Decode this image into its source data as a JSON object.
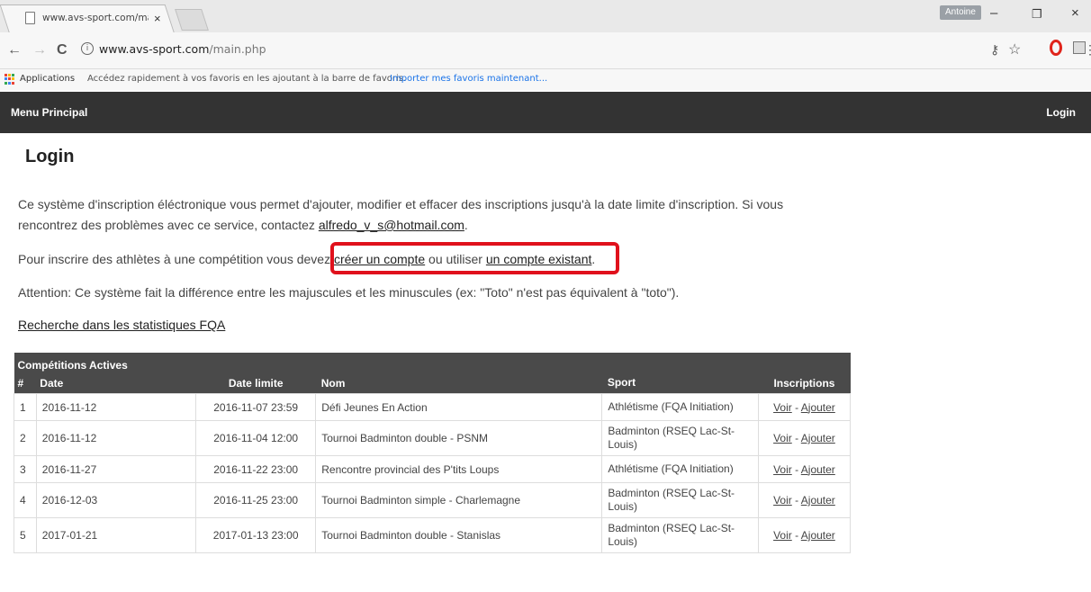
{
  "browser": {
    "tab_title": "www.avs-sport.com/main.php",
    "tab_close": "×",
    "profile_name": "Antoine",
    "url_host": "www.avs-sport.com",
    "url_path": "/main.php",
    "info_glyph": "i",
    "back_icon": "←",
    "forward_icon": "→",
    "reload_icon": "C",
    "key_icon": "⚷",
    "star_icon": "☆",
    "min_icon": "–",
    "max_icon": "❐",
    "close_icon": "×",
    "menu_icon": "⋮",
    "bookmarks": {
      "apps_label": "Applications",
      "hint": "Accédez rapidement à vos favoris en les ajoutant à la barre de favoris.",
      "import_link": "Importer mes favoris maintenant..."
    },
    "colors": {
      "opera_red": "#e0241b",
      "link_blue": "#1a73e8"
    }
  },
  "nav": {
    "left": "Menu Principal",
    "right": "Login"
  },
  "page": {
    "title": "Login",
    "p1_text": "Ce système d'inscription éléctronique vous permet d'ajouter, modifier et effacer des inscriptions jusqu'à la date limite d'inscription. Si vous rencontrez des problèmes avec ce service, contactez ",
    "p1_email": "alfredo_v_s@hotmail.com",
    "p1_end": ".",
    "p2_before": "Pour inscrire des athlètes à une compétition vous devez ",
    "p2_link1": "créer un compte",
    "p2_mid": " ou utiliser ",
    "p2_link2": "un compte existant",
    "p2_end": ".",
    "p3": "Attention: Ce système fait la différence entre les majuscules et les minuscules (ex: \"Toto\" n'est pas équivalent à \"toto\").",
    "p4_link": "Recherche dans les statistiques FQA",
    "highlight_color": "#e0111c"
  },
  "table": {
    "caption": "Compétitions Actives",
    "headers": {
      "num": "#",
      "date": "Date",
      "limit": "Date limite",
      "name": "Nom",
      "sport": "Sport",
      "inscriptions": "Inscriptions"
    },
    "voir": "Voir",
    "sep": " - ",
    "ajouter": "Ajouter",
    "rows": [
      {
        "num": "1",
        "date": "2016-11-12",
        "limit": "2016-11-07 23:59",
        "name": "Défi Jeunes En Action",
        "sport": "Athlétisme (FQA Initiation)"
      },
      {
        "num": "2",
        "date": "2016-11-12",
        "limit": "2016-11-04 12:00",
        "name": "Tournoi Badminton double - PSNM",
        "sport": "Badminton (RSEQ Lac-St-Louis)"
      },
      {
        "num": "3",
        "date": "2016-11-27",
        "limit": "2016-11-22 23:00",
        "name": "Rencontre provincial des P'tits Loups",
        "sport": "Athlétisme (FQA Initiation)"
      },
      {
        "num": "4",
        "date": "2016-12-03",
        "limit": "2016-11-25 23:00",
        "name": "Tournoi Badminton simple - Charlemagne",
        "sport": "Badminton (RSEQ Lac-St-Louis)"
      },
      {
        "num": "5",
        "date": "2017-01-21",
        "limit": "2017-01-13 23:00",
        "name": "Tournoi Badminton double - Stanislas",
        "sport": "Badminton (RSEQ Lac-St-Louis)"
      }
    ]
  }
}
